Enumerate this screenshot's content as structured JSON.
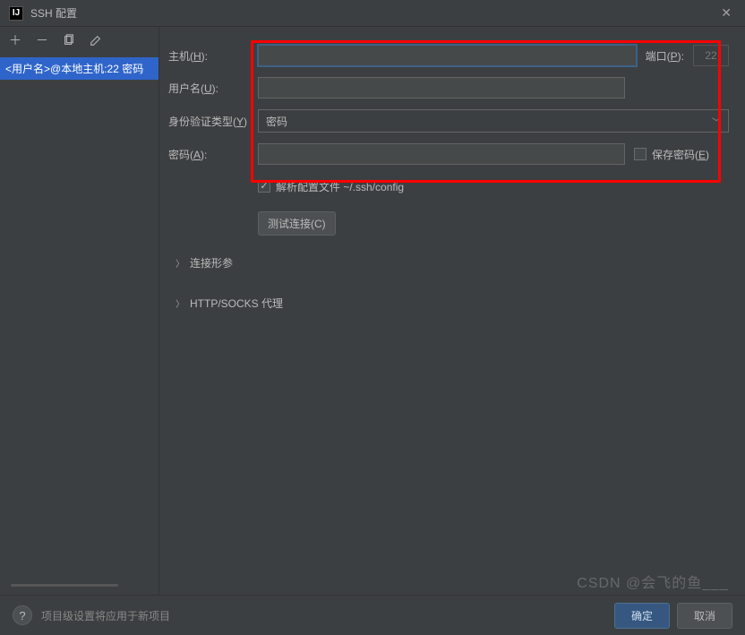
{
  "window": {
    "title": "SSH 配置"
  },
  "sidebar": {
    "items": [
      {
        "label": "<用户名>@本地主机:22 密码"
      }
    ]
  },
  "form": {
    "host_label": "主机(H):",
    "host_value": "",
    "port_label": "端口(P):",
    "port_value": "22",
    "user_label": "用户名(U):",
    "user_value": "",
    "auth_label": "身份验证类型(Y)",
    "auth_value": "密码",
    "password_label": "密码(A):",
    "password_value": "",
    "save_password_label": "保存密码(E)",
    "parse_config_label": "解析配置文件 ~/.ssh/config",
    "test_button": "测试连接(C)"
  },
  "sections": {
    "connection": "连接形参",
    "proxy": "HTTP/SOCKS 代理"
  },
  "bottom": {
    "hint": "项目级设置将应用于新项目",
    "ok": "确定",
    "cancel": "取消"
  },
  "watermark": "CSDN @会飞的鱼___"
}
